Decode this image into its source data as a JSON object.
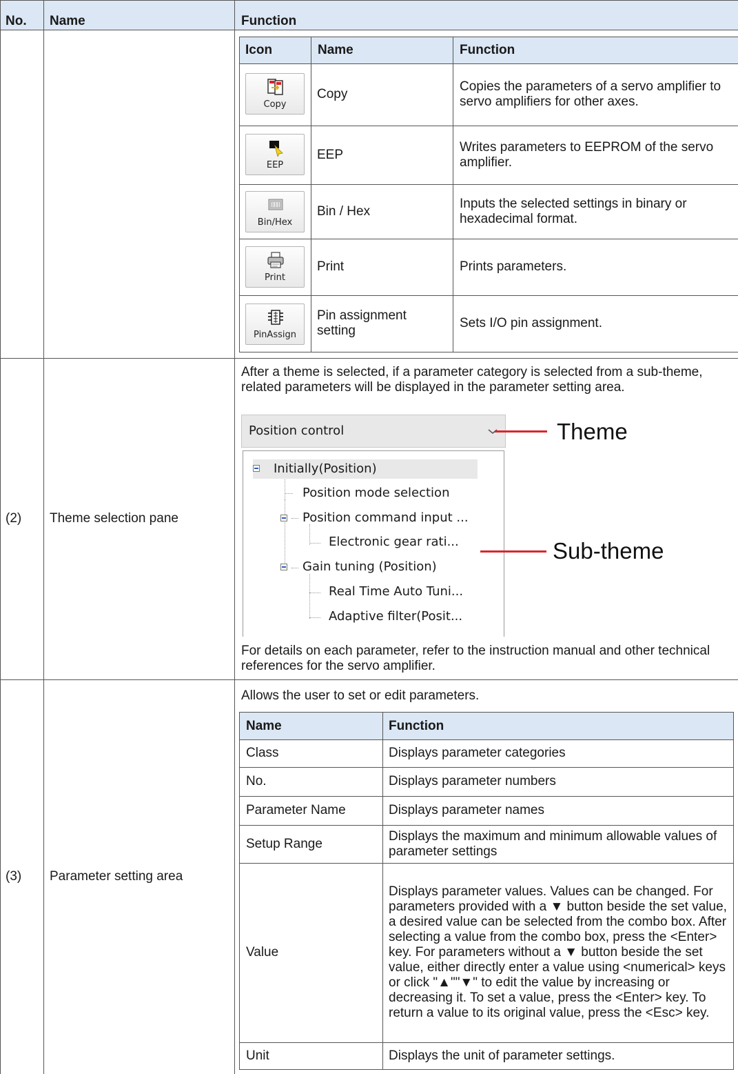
{
  "main_table": {
    "headers": {
      "no": "No.",
      "name": "Name",
      "function": "Function"
    }
  },
  "icon_table": {
    "headers": {
      "icon": "Icon",
      "name": "Name",
      "function": "Function"
    },
    "rows": [
      {
        "icon": "copy-icon",
        "icon_label": "Copy",
        "name": "Copy",
        "function": "Copies the parameters of a servo amplifier to servo amplifiers for other axes."
      },
      {
        "icon": "eep-icon",
        "icon_label": "EEP",
        "name": "EEP",
        "function": "Writes parameters to EEPROM of the servo amplifier."
      },
      {
        "icon": "bin-hex-icon",
        "icon_label": "Bin/Hex",
        "name": "Bin / Hex",
        "function": "Inputs the selected settings in binary or hexadecimal format."
      },
      {
        "icon": "print-icon",
        "icon_label": "Print",
        "name": "Print",
        "function": "Prints parameters."
      },
      {
        "icon": "pin-assign-icon",
        "icon_label": "PinAssign",
        "name": "Pin assignment setting",
        "function": "Sets I/O pin assignment."
      }
    ]
  },
  "section2": {
    "no": "(2)",
    "name": "Theme selection pane",
    "intro": "After a theme is selected, if a parameter category is selected from a sub-theme, related parameters will be displayed in the parameter setting area.",
    "combo_value": "Position control",
    "tree": [
      "Initially(Position)",
      "Position mode selection",
      "Position command input ...",
      "Electronic gear rati...",
      "Gain tuning (Position)",
      "Real Time Auto Tuni...",
      "Adaptive filter(Posit..."
    ],
    "callout_theme": "Theme",
    "callout_subtheme": "Sub-theme",
    "footer": "For details on each parameter, refer to the instruction manual and other technical references for the servo amplifier."
  },
  "section3": {
    "no": "(3)",
    "name": "Parameter setting area",
    "intro": "Allows the user to set or edit parameters.",
    "headers": {
      "name": "Name",
      "function": "Function"
    },
    "rows": [
      {
        "name": "Class",
        "function": "Displays parameter categories"
      },
      {
        "name": "No.",
        "function": "Displays parameter numbers"
      },
      {
        "name": "Parameter Name",
        "function": "Displays parameter names"
      },
      {
        "name": "Setup Range",
        "function": "Displays the maximum and minimum allowable values of parameter settings"
      },
      {
        "name": "Value",
        "function": "Displays parameter values. Values can be changed. For parameters provided with a ▼ button beside the set value, a desired value can be selected from the combo box. After selecting a value from the combo box, press the <Enter> key. For parameters without a ▼ button beside the set value, either directly enter a value using <numerical> keys or click \"▲\"\"▼\" to edit the value by increasing or decreasing it. To set a value, press the <Enter> key. To return a value to its original value, press the <Esc> key."
      },
      {
        "name": "Unit",
        "function": "Displays the unit of parameter settings."
      }
    ]
  }
}
